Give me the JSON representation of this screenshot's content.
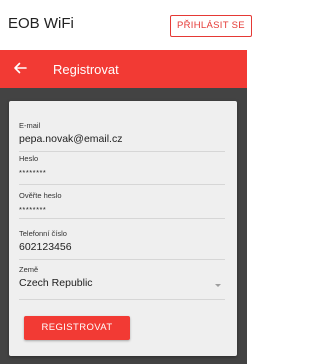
{
  "topbar": {
    "app_title": "EOB WiFi",
    "login_label": "PŘIHLÁSIT SE"
  },
  "header": {
    "title": "Registrovat",
    "back_icon": "arrow-left-icon"
  },
  "form": {
    "email": {
      "label": "E-mail",
      "value": "pepa.novak@email.cz"
    },
    "password": {
      "label": "Heslo",
      "value": "********"
    },
    "password_confirm": {
      "label": "Ověřte heslo",
      "value": "********"
    },
    "phone": {
      "label": "Telefonní číslo",
      "value": "602123456"
    },
    "country": {
      "label": "Země",
      "value": "Czech Republic",
      "icon": "dropdown-caret-icon"
    },
    "submit_label": "REGISTROVAT"
  },
  "colors": {
    "accent": "#f23a34",
    "background_dark": "#434343",
    "card": "#efefef"
  }
}
